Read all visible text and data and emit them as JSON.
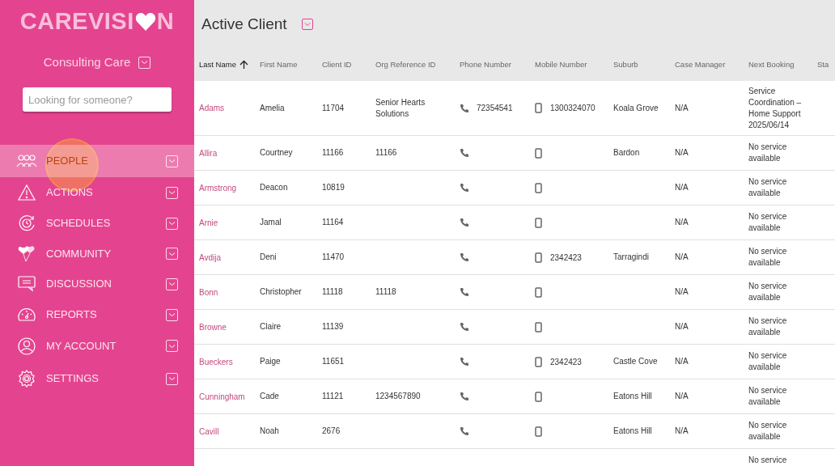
{
  "logo": {
    "text_before": "CAREVISI",
    "text_after": "N"
  },
  "organisation": "Consulting Care",
  "search": {
    "placeholder": "Looking for someone?"
  },
  "nav_items": [
    {
      "label": "PEOPLE",
      "selected": true
    },
    {
      "label": "ACTIONS",
      "selected": false
    },
    {
      "label": "SCHEDULES",
      "selected": false
    },
    {
      "label": "COMMUNITY",
      "selected": false
    },
    {
      "label": "DISCUSSION",
      "selected": false
    },
    {
      "label": "REPORTS",
      "selected": false
    },
    {
      "label": "MY ACCOUNT",
      "selected": false
    },
    {
      "label": "SETTINGS",
      "selected": false
    }
  ],
  "page_title": "Active Client",
  "table": {
    "columns": [
      {
        "label": "Last Name",
        "sorted": true
      },
      {
        "label": "First Name",
        "sorted": false
      },
      {
        "label": "Client ID",
        "sorted": false
      },
      {
        "label": "Org Reference ID",
        "sorted": false
      },
      {
        "label": "Phone Number",
        "sorted": false
      },
      {
        "label": "Mobile Number",
        "sorted": false
      },
      {
        "label": "Suburb",
        "sorted": false
      },
      {
        "label": "Case Manager",
        "sorted": false
      },
      {
        "label": "Next Booking",
        "sorted": false
      },
      {
        "label": "Sta",
        "sorted": false
      }
    ],
    "rows": [
      {
        "last_name": "Adams",
        "first_name": "Amelia",
        "client_id": "11704",
        "org_ref": "Senior Hearts Solutions",
        "phone": "72354541",
        "mobile": "1300324070",
        "suburb": "Koala Grove",
        "case_manager": "N/A",
        "next_booking": "Service Coordination – Home Support 2025/06/14"
      },
      {
        "last_name": "Allira",
        "first_name": "Courtney",
        "client_id": "11166",
        "org_ref": "11166",
        "suburb": "Bardon",
        "case_manager": "N/A",
        "next_booking": "No service available"
      },
      {
        "last_name": "Armstrong",
        "first_name": "Deacon",
        "client_id": "10819",
        "case_manager": "N/A",
        "next_booking": "No service available"
      },
      {
        "last_name": "Arnie",
        "first_name": "Jamal",
        "client_id": "11164",
        "case_manager": "N/A",
        "next_booking": "No service available"
      },
      {
        "last_name": "Avdija",
        "first_name": "Deni",
        "client_id": "11470",
        "mobile": "2342423",
        "suburb": "Tarragindi",
        "case_manager": "N/A",
        "next_booking": "No service available"
      },
      {
        "last_name": "Bonn",
        "first_name": "Christopher",
        "client_id": "11118",
        "org_ref": "11118",
        "case_manager": "N/A",
        "next_booking": "No service available"
      },
      {
        "last_name": "Browne",
        "first_name": "Claire",
        "client_id": "11139",
        "case_manager": "N/A",
        "next_booking": "No service available"
      },
      {
        "last_name": "Bueckers",
        "first_name": "Paige",
        "client_id": "11651",
        "mobile": "2342423",
        "suburb": "Castle Cove",
        "case_manager": "N/A",
        "next_booking": "No service available"
      },
      {
        "last_name": "Cunningham",
        "first_name": "Cade",
        "client_id": "11121",
        "org_ref": "1234567890",
        "suburb": "Eatons Hill",
        "case_manager": "N/A",
        "next_booking": "No service available"
      },
      {
        "last_name": "Cavill",
        "first_name": "Noah",
        "client_id": "2676",
        "suburb": "Eatons Hill",
        "case_manager": "N/A",
        "next_booking": "No service available"
      },
      {
        "next_booking": "No service"
      }
    ]
  }
}
